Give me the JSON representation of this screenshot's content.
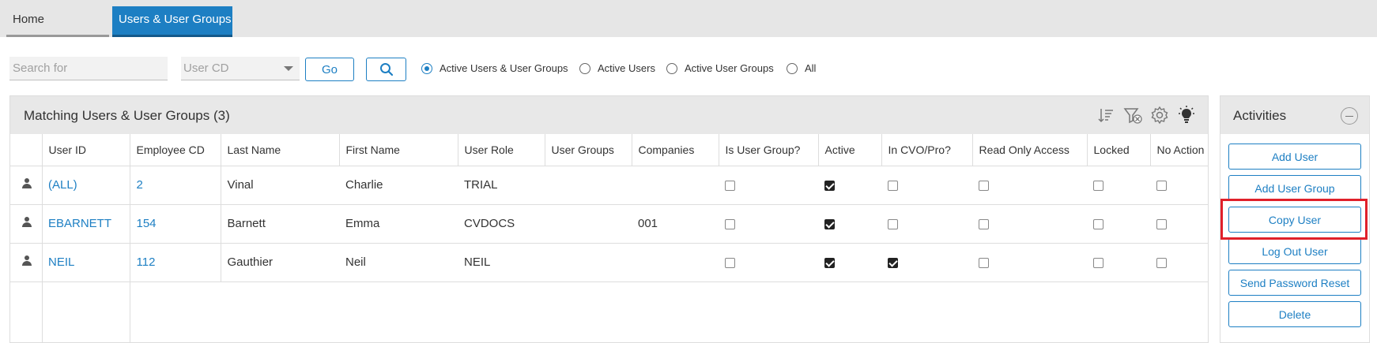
{
  "tabs": [
    {
      "label": "Home"
    },
    {
      "label": "Users & User Groups"
    }
  ],
  "search": {
    "placeholder": "Search for",
    "field_value": "User CD",
    "go_label": "Go"
  },
  "filters": [
    {
      "label": "Active Users & User Groups",
      "selected": true
    },
    {
      "label": "Active Users",
      "selected": false
    },
    {
      "label": "Active User Groups",
      "selected": false
    },
    {
      "label": "All",
      "selected": false
    }
  ],
  "grid": {
    "title": "Matching Users & User Groups (3)",
    "columns": [
      "User ID",
      "Employee CD",
      "Last Name",
      "First Name",
      "User Role",
      "User Groups",
      "Companies",
      "Is User Group?",
      "Active",
      "In CVO/Pro?",
      "Read Only Access",
      "Locked",
      "No Action"
    ],
    "rows": [
      {
        "user_id": "(ALL)",
        "employee_cd": "2",
        "last_name": "Vinal",
        "first_name": "Charlie",
        "user_role": "TRIAL",
        "user_groups": "",
        "companies": "",
        "is_user_group": false,
        "active": true,
        "in_cvo_pro": false,
        "read_only": false,
        "locked": false,
        "no_action": false
      },
      {
        "user_id": "EBARNETT",
        "employee_cd": "154",
        "last_name": "Barnett",
        "first_name": "Emma",
        "user_role": "CVDOCS",
        "user_groups": "",
        "companies": "001",
        "is_user_group": false,
        "active": true,
        "in_cvo_pro": false,
        "read_only": false,
        "locked": false,
        "no_action": false
      },
      {
        "user_id": "NEIL",
        "employee_cd": "112",
        "last_name": "Gauthier",
        "first_name": "Neil",
        "user_role": "NEIL",
        "user_groups": "",
        "companies": "",
        "is_user_group": false,
        "active": true,
        "in_cvo_pro": true,
        "read_only": false,
        "locked": false,
        "no_action": false
      }
    ]
  },
  "activities": {
    "title": "Activities",
    "buttons": [
      {
        "label": "Add User"
      },
      {
        "label": "Add User Group"
      },
      {
        "label": "Copy User",
        "highlighted": true
      },
      {
        "label": "Log Out User"
      },
      {
        "label": "Send Password Reset"
      },
      {
        "label": "Delete"
      }
    ]
  },
  "colors": {
    "accent": "#1d7fc3",
    "highlight": "#e0202a",
    "header_bg": "#e8e8e8"
  }
}
